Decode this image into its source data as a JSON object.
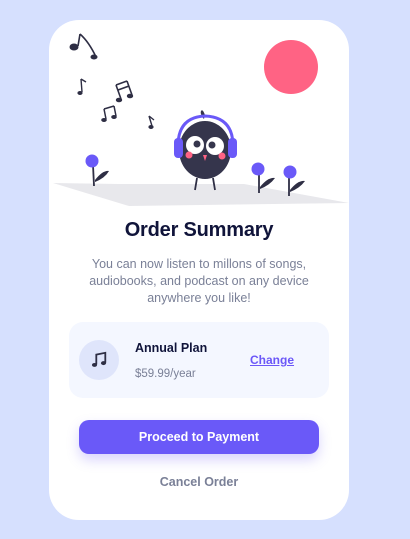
{
  "order": {
    "title": "Order Summary",
    "description": "You can now listen to millons of songs, audiobooks, and podcast on any device anywhere you like!",
    "plan": {
      "name": "Annual Plan",
      "price": "$59.99/year",
      "change_label": "Change",
      "icon": "music-note-icon"
    },
    "actions": {
      "pay_label": "Proceed to Payment",
      "cancel_label": "Cancel Order"
    }
  },
  "colors": {
    "page_background": "#d6e0fe",
    "accent": "#6a59f8",
    "sun": "#ff6384",
    "title": "#10143a",
    "muted": "#7a8097"
  }
}
